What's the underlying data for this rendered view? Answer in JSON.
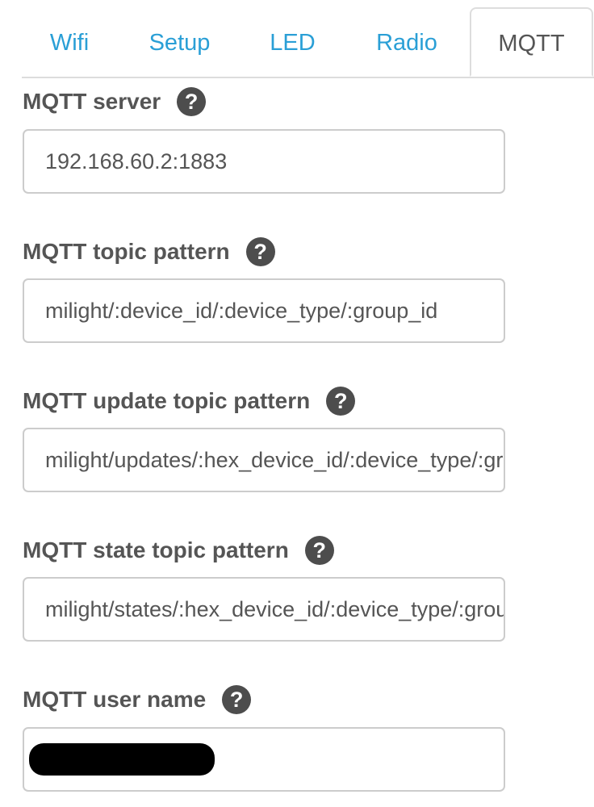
{
  "tabs": [
    {
      "label": "Wifi",
      "active": false
    },
    {
      "label": "Setup",
      "active": false
    },
    {
      "label": "LED",
      "active": false
    },
    {
      "label": "Radio",
      "active": false
    },
    {
      "label": "MQTT",
      "active": true
    }
  ],
  "fields": [
    {
      "label": "MQTT server",
      "value": "192.168.60.2:1883",
      "help_icon": "question-circle"
    },
    {
      "label": "MQTT topic pattern",
      "value": "milight/:device_id/:device_type/:group_id",
      "help_icon": "question-circle"
    },
    {
      "label": "MQTT update topic pattern",
      "value": "milight/updates/:hex_device_id/:device_type/:group_id",
      "help_icon": "question-circle"
    },
    {
      "label": "MQTT state topic pattern",
      "value": "milight/states/:hex_device_id/:device_type/:group_id",
      "help_icon": "question-circle"
    },
    {
      "label": "MQTT user name",
      "value": "",
      "redacted": true,
      "help_icon": "question-circle"
    }
  ],
  "colors": {
    "tab_link": "#2a9fd6",
    "text": "#555555",
    "help_icon_bg": "#4d4d4d",
    "border": "#cccccc"
  }
}
